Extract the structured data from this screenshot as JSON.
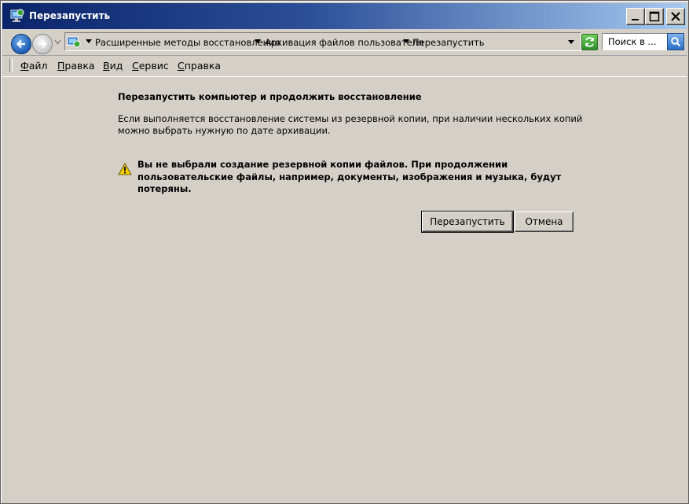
{
  "window": {
    "title": "Перезапустить",
    "controls": {
      "minimize": "minimize",
      "maximize": "maximize",
      "close": "close"
    }
  },
  "navigation": {
    "breadcrumbs": [
      "Расширенные методы восстановления",
      "Архивация файлов пользователя",
      "Перезапустить"
    ],
    "search_placeholder": "Поиск в ..."
  },
  "menu": {
    "items": [
      "Файл",
      "Правка",
      "Вид",
      "Сервис",
      "Справка"
    ]
  },
  "content": {
    "heading": "Перезапустить компьютер и продолжить восстановление",
    "description": "Если выполняется восстановление системы из резервной копии, при наличии нескольких копий можно выбрать нужную по дате архивации.",
    "warning": "Вы не выбрали создание резервной копии файлов. При продолжении пользовательские файлы, например, документы, изображения и музыка, будут потеряны.",
    "buttons": {
      "restart": "Перезапустить",
      "cancel": "Отмена"
    }
  },
  "colors": {
    "titlebar_start": "#0a246a",
    "titlebar_end": "#a6caf0",
    "background": "#d4d0c8",
    "warning_yellow": "#f5d000"
  }
}
